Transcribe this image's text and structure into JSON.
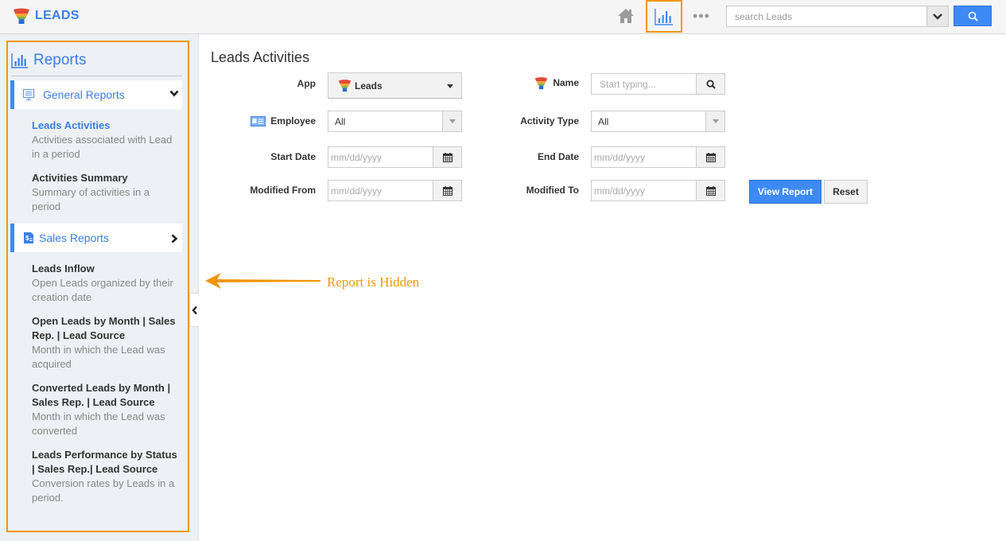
{
  "app": {
    "title": "LEADS",
    "logo_icon": "funnel-icon"
  },
  "topbar": {
    "home_icon": "home-icon",
    "reports_icon": "bar-chart-icon",
    "more_icon": "more-dots-icon",
    "more_glyph": "•••",
    "search_placeholder": "search Leads",
    "search_dropdown_icon": "chevron-down-icon",
    "search_button_icon": "search-icon"
  },
  "sidebar": {
    "title": "Reports",
    "groups": [
      {
        "label": "General Reports",
        "icon": "monitor-icon",
        "expanded": true,
        "items": [
          {
            "name": "Leads Activities",
            "description": "Activities associated with Lead in a period",
            "active": true
          },
          {
            "name": "Activities Summary",
            "description": "Summary of activities in a period",
            "active": false
          }
        ]
      },
      {
        "label": "Sales Reports",
        "icon": "sales-document-icon",
        "expanded": false,
        "items": [
          {
            "name": "Leads Inflow",
            "description": "Open Leads organized by their creation date"
          },
          {
            "name": "Open Leads by Month | Sales Rep. | Lead Source",
            "description": "Month in which the Lead was acquired"
          },
          {
            "name": "Converted Leads by Month | Sales Rep. | Lead Source",
            "description": "Month in which the Lead was converted"
          },
          {
            "name": "Leads Performance by Status | Sales Rep.| Lead Source",
            "description": "Conversion rates by Leads in a period."
          }
        ]
      }
    ],
    "collapse_icon": "chevron-left-icon"
  },
  "main": {
    "title": "Leads Activities",
    "form": {
      "app_label": "App",
      "app_value": "Leads",
      "name_label": "Name",
      "name_placeholder": "Start typing...",
      "employee_label": "Employee",
      "employee_value": "All",
      "activity_type_label": "Activity Type",
      "activity_type_value": "All",
      "start_date_label": "Start Date",
      "start_date_placeholder": "mm/dd/yyyy",
      "end_date_label": "End Date",
      "end_date_placeholder": "mm/dd/yyyy",
      "modified_from_label": "Modified From",
      "modified_from_placeholder": "mm/dd/yyyy",
      "modified_to_label": "Modified To",
      "modified_to_placeholder": "mm/dd/yyyy"
    },
    "buttons": {
      "view_report": "View Report",
      "reset": "Reset"
    }
  },
  "annotation": {
    "text": "Report is Hidden",
    "color": "#f0960a"
  },
  "colors": {
    "accent": "#3a7ee4",
    "primary_button": "#3d8af7",
    "highlight": "#f0960a"
  }
}
